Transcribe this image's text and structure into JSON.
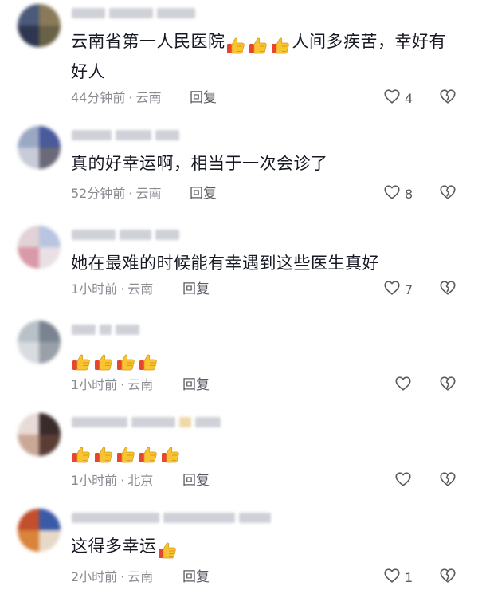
{
  "comments": [
    {
      "text": "云南省第一人民医院",
      "emoji_after_text": "thumbs-up-emoji",
      "emoji_count": 3,
      "text_tail": "人间多疾苦，幸好有好人",
      "time": "44分钟前",
      "location": "云南",
      "reply_label": "回复",
      "like_count": "4",
      "avatar_colors": [
        "#4a5a78",
        "#8a7a5a",
        "#2e3650",
        "#6a6246"
      ]
    },
    {
      "text": "真的好幸运啊，相当于一次会诊了",
      "time": "52分钟前",
      "location": "云南",
      "reply_label": "回复",
      "like_count": "8",
      "avatar_colors": [
        "#9aa8c4",
        "#4a5a9a",
        "#c8ccd8",
        "#6a6a78"
      ]
    },
    {
      "text": "她在最难的时候能有幸遇到这些医生真好",
      "time": "1小时前",
      "location": "云南",
      "reply_label": "回复",
      "like_count": "7",
      "avatar_colors": [
        "#e0d2d6",
        "#b8c4e0",
        "#d89aa8",
        "#e8e0e4"
      ]
    },
    {
      "text": "",
      "emoji_count": 4,
      "emoji_after_text": "thumbs-up-emoji",
      "time": "1小时前",
      "location": "云南",
      "reply_label": "回复",
      "like_count": "",
      "avatar_colors": [
        "#b8c0c8",
        "#7a8490",
        "#d8dce0",
        "#9aa0a8"
      ]
    },
    {
      "text": "",
      "emoji_count": 5,
      "emoji_after_text": "thumbs-up-emoji",
      "time": "1小时前",
      "location": "北京",
      "reply_label": "回复",
      "like_count": "",
      "avatar_colors": [
        "#e8dad6",
        "#3a2a2a",
        "#caa898",
        "#5a3e36"
      ]
    },
    {
      "text": "这得多幸运",
      "emoji_after_text": "thumbs-up-emoji",
      "emoji_count": 1,
      "time": "2小时前",
      "location": "云南",
      "reply_label": "回复",
      "like_count": "1",
      "avatar_colors": [
        "#c2502e",
        "#3a5aa8",
        "#d8843a",
        "#e8d8c8"
      ]
    }
  ],
  "colors": {
    "text": "#161823",
    "meta": "#8a8b91",
    "icon": "#5a5b62"
  }
}
